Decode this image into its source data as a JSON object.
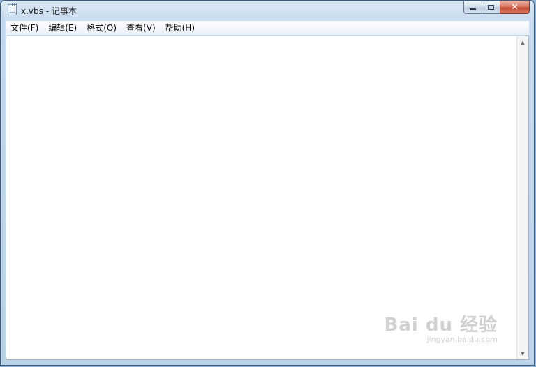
{
  "window": {
    "title": "x.vbs - 记事本",
    "close_glyph": "✕"
  },
  "menu": {
    "items": [
      {
        "label": "文件(F)"
      },
      {
        "label": "编辑(E)"
      },
      {
        "label": "格式(O)"
      },
      {
        "label": "查看(V)"
      },
      {
        "label": "帮助(H)"
      }
    ]
  },
  "editor": {
    "content": ""
  },
  "scrollbar": {
    "up_glyph": "▲",
    "down_glyph": "▼"
  },
  "watermark": {
    "main": "Bai du 经验",
    "sub": "jingyan.baidu.com"
  },
  "colors": {
    "title_gradient_top": "#dce9f6",
    "close_button": "#c44a33",
    "editor_bg": "#ffffff"
  }
}
